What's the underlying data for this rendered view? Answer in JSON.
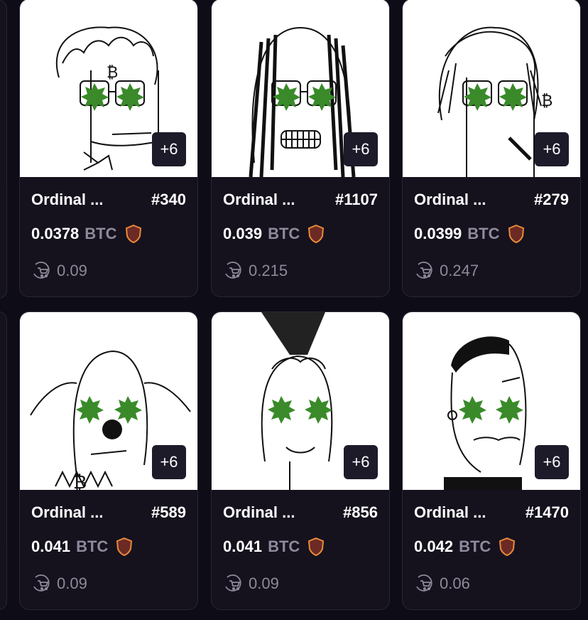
{
  "cards": [
    {
      "name": "Ordinal ...",
      "number": "#340",
      "price": "0.0378",
      "unit": "BTC",
      "badge": "+6",
      "last_sale": "0.09"
    },
    {
      "name": "Ordinal ...",
      "number": "#1107",
      "price": "0.039",
      "unit": "BTC",
      "badge": "+6",
      "last_sale": "0.215"
    },
    {
      "name": "Ordinal ...",
      "number": "#279",
      "price": "0.0399",
      "unit": "BTC",
      "badge": "+6",
      "last_sale": "0.247"
    },
    {
      "name": "Ordinal ...",
      "number": "#589",
      "price": "0.041",
      "unit": "BTC",
      "badge": "+6",
      "last_sale": "0.09"
    },
    {
      "name": "Ordinal ...",
      "number": "#856",
      "price": "0.041",
      "unit": "BTC",
      "badge": "+6",
      "last_sale": "0.09"
    },
    {
      "name": "Ordinal ...",
      "number": "#1470",
      "price": "0.042",
      "unit": "BTC",
      "badge": "+6",
      "last_sale": "0.06"
    }
  ],
  "icons": {
    "verified": "shield-icon",
    "last_sale": "cart-icon"
  },
  "colors": {
    "background": "#0e0c16",
    "card": "#15121e",
    "shield_fill": "#6b2a24",
    "shield_stroke": "#e8893a",
    "eyes": "#3a8a2a"
  }
}
